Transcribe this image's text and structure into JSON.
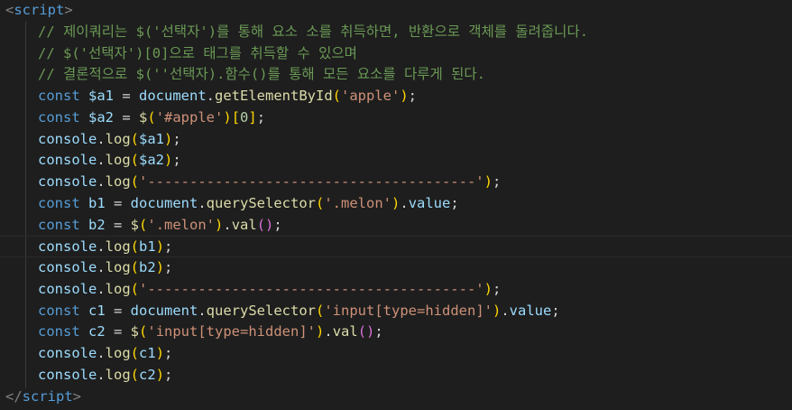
{
  "colors": {
    "background": "#1e1e1e",
    "tag_bracket": "#808080",
    "tag_name": "#569cd6",
    "comment": "#6a9955",
    "keyword": "#569cd6",
    "variable": "#9cdcfe",
    "function": "#dcdcaa",
    "string": "#ce9178",
    "number": "#b5cea8",
    "bracket": "#ffd700",
    "bracket2": "#da70d6",
    "plain": "#d4d4d4"
  },
  "editor": {
    "lines": [
      {
        "indent": false,
        "tokens": [
          {
            "t": "<",
            "c": "tag_bracket"
          },
          {
            "t": "script",
            "c": "tag_name"
          },
          {
            "t": ">",
            "c": "tag_bracket"
          }
        ]
      },
      {
        "indent": true,
        "tokens": [
          {
            "t": "// 제이쿼리는 $('선택자')를 통해 요소 소를 취득하면, 반환으로 객체를 돌려줍니다.",
            "c": "comment"
          }
        ]
      },
      {
        "indent": true,
        "tokens": [
          {
            "t": "// $('선택자')[0]으로 태그를 취득할 수 있으며",
            "c": "comment"
          }
        ]
      },
      {
        "indent": true,
        "tokens": [
          {
            "t": "// 결론적으로 $(''선택자).함수()를 통해 모든 요소를 다루게 된다.",
            "c": "comment"
          }
        ]
      },
      {
        "indent": true,
        "tokens": [
          {
            "t": "const ",
            "c": "keyword"
          },
          {
            "t": "$a1",
            "c": "variable"
          },
          {
            "t": " = ",
            "c": "plain"
          },
          {
            "t": "document",
            "c": "variable"
          },
          {
            "t": ".",
            "c": "plain"
          },
          {
            "t": "getElementById",
            "c": "function"
          },
          {
            "t": "(",
            "c": "bracket"
          },
          {
            "t": "'apple'",
            "c": "string"
          },
          {
            "t": ")",
            "c": "bracket"
          },
          {
            "t": ";",
            "c": "plain"
          }
        ]
      },
      {
        "indent": true,
        "tokens": [
          {
            "t": "const ",
            "c": "keyword"
          },
          {
            "t": "$a2",
            "c": "variable"
          },
          {
            "t": " = ",
            "c": "plain"
          },
          {
            "t": "$",
            "c": "function"
          },
          {
            "t": "(",
            "c": "bracket"
          },
          {
            "t": "'#apple'",
            "c": "string"
          },
          {
            "t": ")",
            "c": "bracket"
          },
          {
            "t": "[",
            "c": "bracket"
          },
          {
            "t": "0",
            "c": "number"
          },
          {
            "t": "]",
            "c": "bracket"
          },
          {
            "t": ";",
            "c": "plain"
          }
        ]
      },
      {
        "indent": true,
        "tokens": [
          {
            "t": "console",
            "c": "variable"
          },
          {
            "t": ".",
            "c": "plain"
          },
          {
            "t": "log",
            "c": "function"
          },
          {
            "t": "(",
            "c": "bracket"
          },
          {
            "t": "$a1",
            "c": "variable"
          },
          {
            "t": ")",
            "c": "bracket"
          },
          {
            "t": ";",
            "c": "plain"
          }
        ]
      },
      {
        "indent": true,
        "tokens": [
          {
            "t": "console",
            "c": "variable"
          },
          {
            "t": ".",
            "c": "plain"
          },
          {
            "t": "log",
            "c": "function"
          },
          {
            "t": "(",
            "c": "bracket"
          },
          {
            "t": "$a2",
            "c": "variable"
          },
          {
            "t": ")",
            "c": "bracket"
          },
          {
            "t": ";",
            "c": "plain"
          }
        ]
      },
      {
        "indent": true,
        "tokens": [
          {
            "t": "console",
            "c": "variable"
          },
          {
            "t": ".",
            "c": "plain"
          },
          {
            "t": "log",
            "c": "function"
          },
          {
            "t": "(",
            "c": "bracket"
          },
          {
            "t": "'---------------------------------------'",
            "c": "string"
          },
          {
            "t": ")",
            "c": "bracket"
          },
          {
            "t": ";",
            "c": "plain"
          }
        ]
      },
      {
        "indent": true,
        "tokens": [
          {
            "t": "const ",
            "c": "keyword"
          },
          {
            "t": "b1",
            "c": "variable"
          },
          {
            "t": " = ",
            "c": "plain"
          },
          {
            "t": "document",
            "c": "variable"
          },
          {
            "t": ".",
            "c": "plain"
          },
          {
            "t": "querySelector",
            "c": "function"
          },
          {
            "t": "(",
            "c": "bracket"
          },
          {
            "t": "'.melon'",
            "c": "string"
          },
          {
            "t": ")",
            "c": "bracket"
          },
          {
            "t": ".",
            "c": "plain"
          },
          {
            "t": "value",
            "c": "variable"
          },
          {
            "t": ";",
            "c": "plain"
          }
        ]
      },
      {
        "indent": true,
        "tokens": [
          {
            "t": "const ",
            "c": "keyword"
          },
          {
            "t": "b2",
            "c": "variable"
          },
          {
            "t": " = ",
            "c": "plain"
          },
          {
            "t": "$",
            "c": "function"
          },
          {
            "t": "(",
            "c": "bracket"
          },
          {
            "t": "'.melon'",
            "c": "string"
          },
          {
            "t": ")",
            "c": "bracket"
          },
          {
            "t": ".",
            "c": "plain"
          },
          {
            "t": "val",
            "c": "function"
          },
          {
            "t": "()",
            "c": "bracket2"
          },
          {
            "t": ";",
            "c": "plain"
          }
        ]
      },
      {
        "indent": true,
        "current": true,
        "tokens": [
          {
            "t": "console",
            "c": "variable"
          },
          {
            "t": ".",
            "c": "plain"
          },
          {
            "t": "log",
            "c": "function"
          },
          {
            "t": "(",
            "c": "bracket"
          },
          {
            "t": "b1",
            "c": "variable"
          },
          {
            "t": ")",
            "c": "bracket"
          },
          {
            "t": ";",
            "c": "plain"
          }
        ]
      },
      {
        "indent": true,
        "tokens": [
          {
            "t": "console",
            "c": "variable"
          },
          {
            "t": ".",
            "c": "plain"
          },
          {
            "t": "log",
            "c": "function"
          },
          {
            "t": "(",
            "c": "bracket"
          },
          {
            "t": "b2",
            "c": "variable"
          },
          {
            "t": ")",
            "c": "bracket"
          },
          {
            "t": ";",
            "c": "plain"
          }
        ]
      },
      {
        "indent": true,
        "tokens": [
          {
            "t": "console",
            "c": "variable"
          },
          {
            "t": ".",
            "c": "plain"
          },
          {
            "t": "log",
            "c": "function"
          },
          {
            "t": "(",
            "c": "bracket"
          },
          {
            "t": "'---------------------------------------'",
            "c": "string"
          },
          {
            "t": ")",
            "c": "bracket"
          },
          {
            "t": ";",
            "c": "plain"
          }
        ]
      },
      {
        "indent": true,
        "tokens": [
          {
            "t": "const ",
            "c": "keyword"
          },
          {
            "t": "c1",
            "c": "variable"
          },
          {
            "t": " = ",
            "c": "plain"
          },
          {
            "t": "document",
            "c": "variable"
          },
          {
            "t": ".",
            "c": "plain"
          },
          {
            "t": "querySelector",
            "c": "function"
          },
          {
            "t": "(",
            "c": "bracket"
          },
          {
            "t": "'input[type=hidden]'",
            "c": "string"
          },
          {
            "t": ")",
            "c": "bracket"
          },
          {
            "t": ".",
            "c": "plain"
          },
          {
            "t": "value",
            "c": "variable"
          },
          {
            "t": ";",
            "c": "plain"
          }
        ]
      },
      {
        "indent": true,
        "tokens": [
          {
            "t": "const ",
            "c": "keyword"
          },
          {
            "t": "c2",
            "c": "variable"
          },
          {
            "t": " = ",
            "c": "plain"
          },
          {
            "t": "$",
            "c": "function"
          },
          {
            "t": "(",
            "c": "bracket"
          },
          {
            "t": "'input[type=hidden]'",
            "c": "string"
          },
          {
            "t": ")",
            "c": "bracket"
          },
          {
            "t": ".",
            "c": "plain"
          },
          {
            "t": "val",
            "c": "function"
          },
          {
            "t": "()",
            "c": "bracket2"
          },
          {
            "t": ";",
            "c": "plain"
          }
        ]
      },
      {
        "indent": true,
        "tokens": [
          {
            "t": "console",
            "c": "variable"
          },
          {
            "t": ".",
            "c": "plain"
          },
          {
            "t": "log",
            "c": "function"
          },
          {
            "t": "(",
            "c": "bracket"
          },
          {
            "t": "c1",
            "c": "variable"
          },
          {
            "t": ")",
            "c": "bracket"
          },
          {
            "t": ";",
            "c": "plain"
          }
        ]
      },
      {
        "indent": true,
        "tokens": [
          {
            "t": "console",
            "c": "variable"
          },
          {
            "t": ".",
            "c": "plain"
          },
          {
            "t": "log",
            "c": "function"
          },
          {
            "t": "(",
            "c": "bracket"
          },
          {
            "t": "c2",
            "c": "variable"
          },
          {
            "t": ")",
            "c": "bracket"
          },
          {
            "t": ";",
            "c": "plain"
          }
        ]
      },
      {
        "indent": false,
        "tokens": [
          {
            "t": "</",
            "c": "tag_bracket"
          },
          {
            "t": "script",
            "c": "tag_name"
          },
          {
            "t": ">",
            "c": "tag_bracket"
          }
        ]
      }
    ]
  }
}
